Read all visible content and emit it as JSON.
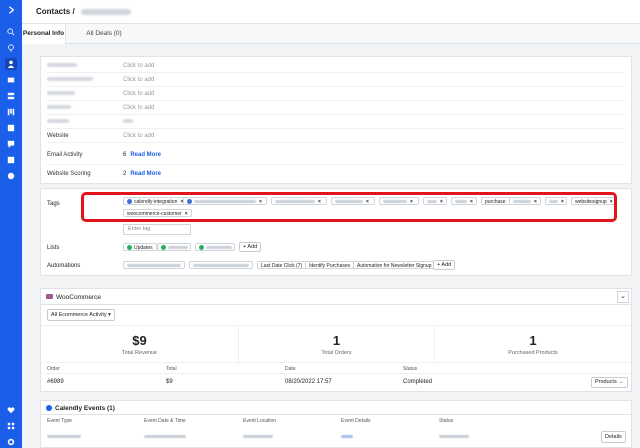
{
  "header": {
    "breadcrumb": "Contacts /"
  },
  "tabs": [
    {
      "label": "Personal Info"
    },
    {
      "label": "All Deals (0)"
    }
  ],
  "fields": {
    "click_to_add": "Click to add",
    "website_label": "Website",
    "email_activity": {
      "label": "Email Activity",
      "count": "6",
      "link": "Read More"
    },
    "website_scoring": {
      "label": "Website Scoring",
      "count": "2",
      "link": "Read More"
    }
  },
  "tags": {
    "label": "Tags",
    "items": [
      "calendly-integration",
      "purchase",
      "websitesignup",
      "woocommerce-customer"
    ],
    "close": "×",
    "enter_placeholder": "Enter tag"
  },
  "lists": {
    "label": "Lists",
    "items": [
      "Updates"
    ],
    "add": "+ Add"
  },
  "automations": {
    "label": "Automations",
    "items": [
      "Last Date Click",
      "(7)",
      "Identify Purchases",
      "Automation for Newsletter Signup"
    ],
    "add": "+ Add"
  },
  "woocommerce": {
    "title": "WooCommerce",
    "filter": "All Ecommerce Activity",
    "metrics": [
      {
        "value": "$9",
        "caption": "Total Revenue"
      },
      {
        "value": "1",
        "caption": "Total Orders"
      },
      {
        "value": "1",
        "caption": "Purchased Products"
      }
    ],
    "columns": [
      "Order",
      "Total",
      "Date",
      "Status"
    ],
    "row": {
      "order": "#6989",
      "total": "$9",
      "date": "08/20/2022 17:57",
      "status": "Completed"
    },
    "products_button": "Products"
  },
  "calendly": {
    "title": "Calendly Events (1)",
    "columns": [
      "Event Type",
      "Event Date & Time",
      "Event Location",
      "Event Details",
      "Status"
    ],
    "details_button": "Details"
  },
  "colors": {
    "sidebar": "#1a5eea",
    "highlight": "#e1141b",
    "link": "#1a5eea"
  }
}
